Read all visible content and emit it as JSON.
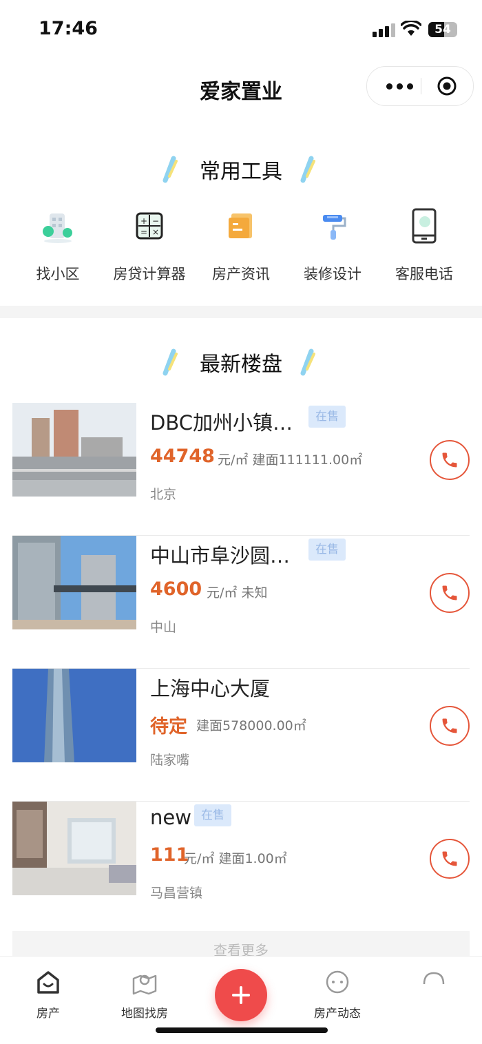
{
  "status_bar": {
    "time": "17:46",
    "battery": "54",
    "battery_level": 0.54
  },
  "navbar": {
    "title": "爱家置业"
  },
  "tools_section": {
    "title": "常用工具",
    "items": [
      {
        "label": "找小区",
        "icon": "community-icon"
      },
      {
        "label": "房贷计算器",
        "icon": "calculator-icon"
      },
      {
        "label": "房产资讯",
        "icon": "news-icon"
      },
      {
        "label": "装修设计",
        "icon": "paint-roller-icon"
      },
      {
        "label": "客服电话",
        "icon": "mobile-phone-icon"
      }
    ]
  },
  "listings_section": {
    "title": "最新楼盘",
    "more_label": "查看更多",
    "listings": [
      {
        "name": "DBC加州小镇…",
        "badge": "在售",
        "price": "44748",
        "unit_area": "元/㎡  建面111111.00㎡",
        "location": "北京"
      },
      {
        "name": "中山市阜沙圆…",
        "badge": "在售",
        "price": "4600",
        "unit_area": "元/㎡  未知",
        "location": "中山"
      },
      {
        "name": "上海中心大厦",
        "badge": "",
        "price": "待定",
        "unit_area": "建面578000.00㎡",
        "location": "陆家嘴"
      },
      {
        "name": "new",
        "badge": "在售",
        "price": "111",
        "unit_area": "元/㎡  建面1.00㎡",
        "location": "马昌营镇"
      }
    ]
  },
  "tabbar": {
    "items": [
      {
        "label": "房产",
        "icon": "house-icon"
      },
      {
        "label": "地图找房",
        "icon": "map-pin-icon"
      },
      {
        "label": "",
        "icon": "plus-icon"
      },
      {
        "label": "房产动态",
        "icon": "chat-icon"
      },
      {
        "label": "",
        "icon": "user-icon"
      }
    ]
  },
  "colors": {
    "accent": "#e0642a",
    "phone": "#e5563a",
    "fab": "#ef4b4b",
    "badge_bg": "#dbe9fb"
  }
}
